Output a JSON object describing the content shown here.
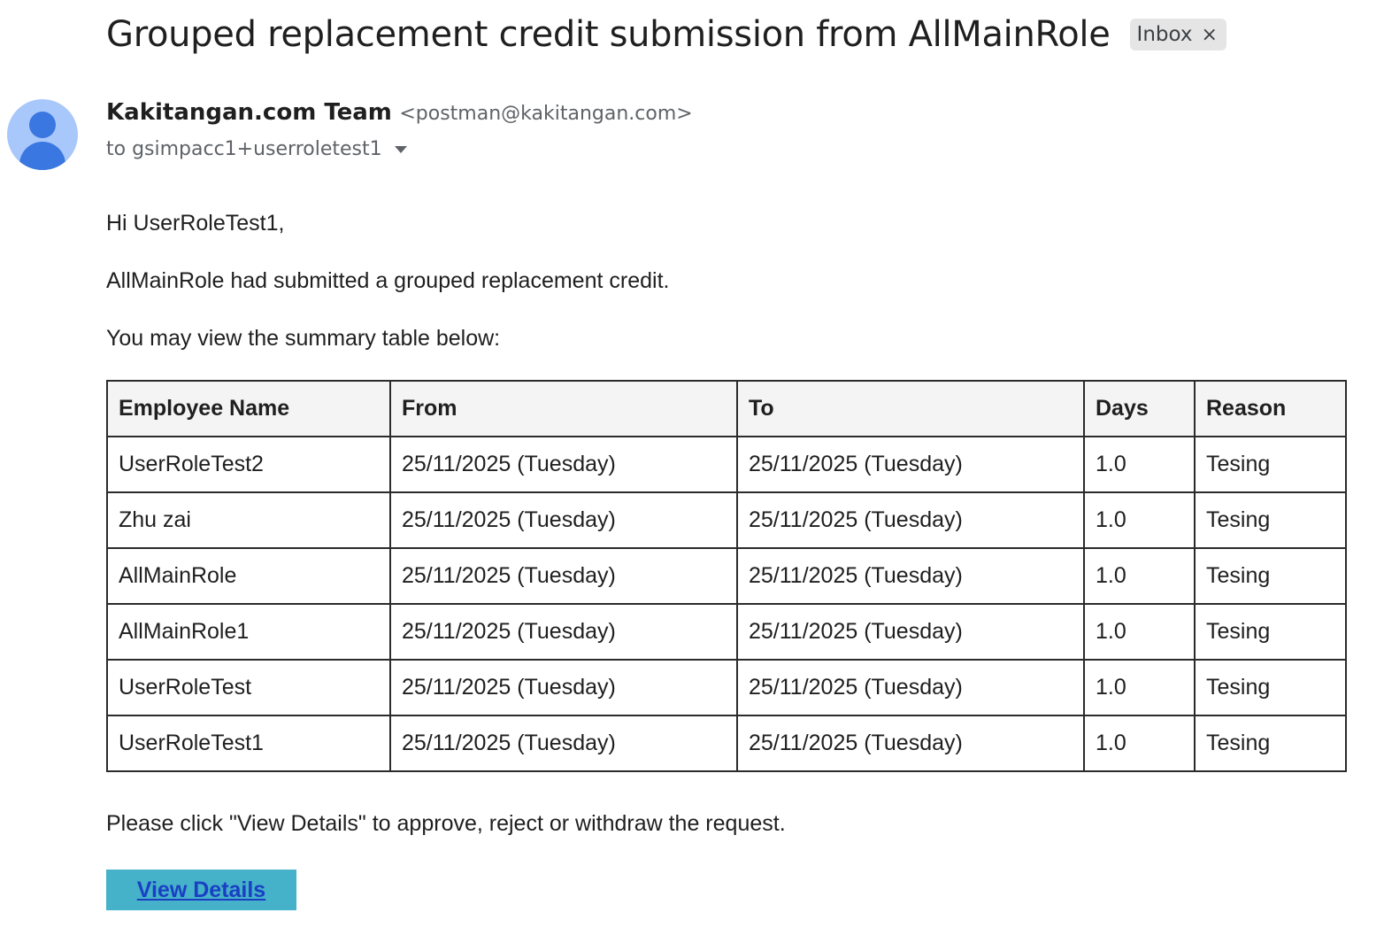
{
  "email": {
    "subject": "Grouped replacement credit submission from AllMainRole",
    "label_chip": {
      "text": "Inbox",
      "close_glyph": "×"
    },
    "sender": {
      "name": "Kakitangan.com Team",
      "email": "<postman@kakitangan.com>",
      "avatar_icon": "person-icon"
    },
    "recipient": "to gsimpacc1+userroletest1"
  },
  "body": {
    "greeting": "Hi UserRoleTest1,",
    "line1": "AllMainRole had submitted a grouped replacement credit.",
    "line2": "You may view the summary table below:",
    "table": {
      "columns": [
        "Employee Name",
        "From",
        "To",
        "Days",
        "Reason"
      ],
      "rows": [
        [
          "UserRoleTest2",
          "25/11/2025 (Tuesday)",
          "25/11/2025 (Tuesday)",
          "1.0",
          "Tesing"
        ],
        [
          "Zhu zai",
          "25/11/2025 (Tuesday)",
          "25/11/2025 (Tuesday)",
          "1.0",
          "Tesing"
        ],
        [
          "AllMainRole",
          "25/11/2025 (Tuesday)",
          "25/11/2025 (Tuesday)",
          "1.0",
          "Tesing"
        ],
        [
          "AllMainRole1",
          "25/11/2025 (Tuesday)",
          "25/11/2025 (Tuesday)",
          "1.0",
          "Tesing"
        ],
        [
          "UserRoleTest",
          "25/11/2025 (Tuesday)",
          "25/11/2025 (Tuesday)",
          "1.0",
          "Tesing"
        ],
        [
          "UserRoleTest1",
          "25/11/2025 (Tuesday)",
          "25/11/2025 (Tuesday)",
          "1.0",
          "Tesing"
        ]
      ]
    },
    "instruction": "Please click \"View Details\" to approve, reject or withdraw the request.",
    "button_label": "View Details"
  },
  "colors": {
    "button_bg": "#45b2c9",
    "button_text": "#1a3fc4",
    "avatar_bg": "#a8c7fa",
    "avatar_fg": "#3b77e0",
    "chip_bg": "#e5e5e5"
  }
}
